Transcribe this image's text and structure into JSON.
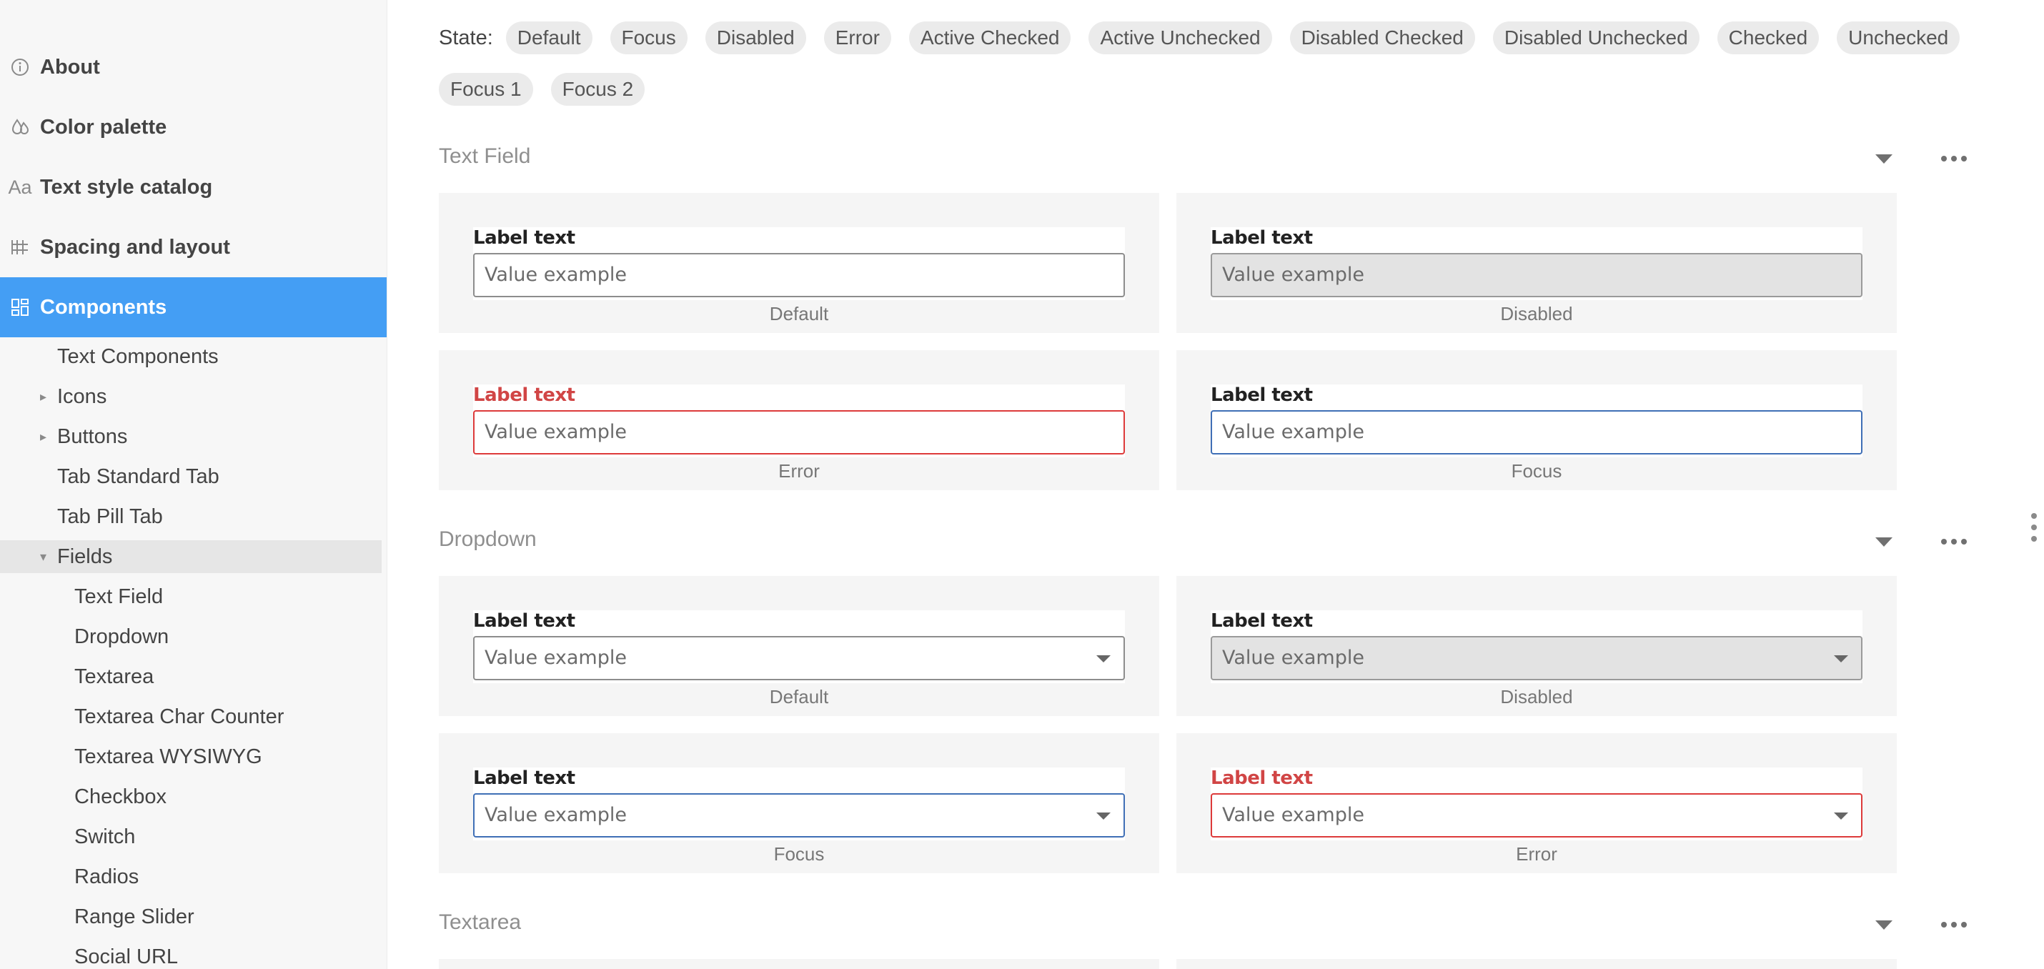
{
  "sidebar": {
    "top_items": [
      {
        "label": "About",
        "icon": "info-icon"
      },
      {
        "label": "Color palette",
        "icon": "droplets-icon"
      },
      {
        "label": "Text style catalog",
        "icon": "text-style-icon",
        "icon_text": "Aa"
      },
      {
        "label": "Spacing and layout",
        "icon": "grid-icon"
      },
      {
        "label": "Components",
        "icon": "components-icon",
        "active": true
      }
    ],
    "tree": [
      {
        "label": "Text Components"
      },
      {
        "label": "Icons",
        "expandable": true
      },
      {
        "label": "Buttons",
        "expandable": true
      },
      {
        "label": "Tab Standard Tab"
      },
      {
        "label": "Tab Pill Tab"
      },
      {
        "label": "Fields",
        "expanded": true,
        "selected": true
      },
      {
        "label": "Text Field"
      },
      {
        "label": "Dropdown"
      },
      {
        "label": "Textarea"
      },
      {
        "label": "Textarea Char Counter"
      },
      {
        "label": "Textarea WYSIWYG"
      },
      {
        "label": "Checkbox"
      },
      {
        "label": "Switch"
      },
      {
        "label": "Radios"
      },
      {
        "label": "Range Slider"
      },
      {
        "label": "Social URL"
      }
    ]
  },
  "state_filter": {
    "label": "State:",
    "chips": [
      "Default",
      "Focus",
      "Disabled",
      "Error",
      "Active Checked",
      "Active Unchecked",
      "Disabled Checked",
      "Disabled Unchecked",
      "Checked",
      "Unchecked",
      "Focus 1",
      "Focus 2"
    ]
  },
  "sections": [
    {
      "title": "Text Field",
      "cards": [
        {
          "label": "Label text",
          "value": "Value example",
          "caption": "Default",
          "state": "default"
        },
        {
          "label": "Label text",
          "value": "Value example",
          "caption": "Disabled",
          "state": "disabled"
        },
        {
          "label": "Label text",
          "value": "Value example",
          "caption": "Error",
          "state": "error"
        },
        {
          "label": "Label text",
          "value": "Value example",
          "caption": "Focus",
          "state": "focus"
        }
      ]
    },
    {
      "title": "Dropdown",
      "cards": [
        {
          "label": "Label text",
          "value": "Value example",
          "caption": "Default",
          "state": "default"
        },
        {
          "label": "Label text",
          "value": "Value example",
          "caption": "Disabled",
          "state": "disabled"
        },
        {
          "label": "Label text",
          "value": "Value example",
          "caption": "Focus",
          "state": "focus"
        },
        {
          "label": "Label text",
          "value": "Value example",
          "caption": "Error",
          "state": "error"
        }
      ]
    },
    {
      "title": "Textarea",
      "cards": []
    }
  ],
  "colors": {
    "active_nav": "#449ef4",
    "error": "#dd3a3a",
    "focus": "#3f6fb6",
    "card_bg": "#f5f5f5"
  }
}
